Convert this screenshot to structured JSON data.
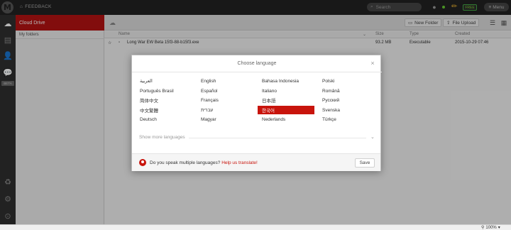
{
  "topbar": {
    "feedback_label": "FEEDBACK",
    "search_placeholder": "Search",
    "plan_badge": "FREE",
    "menu_label": "Menu"
  },
  "sidebar": {
    "cloud_drive_label": "Cloud Drive",
    "my_folders_label": "My folders",
    "rail_badge": "BETA"
  },
  "toolbar": {
    "new_folder_label": "New Folder",
    "file_upload_label": "File Upload"
  },
  "file_table": {
    "columns": [
      "Name",
      "Size",
      "Type",
      "Created"
    ],
    "rows": [
      {
        "name": "Long War EW Beta 15f3-88-b15f3.exe",
        "size": "93.2 MB",
        "type": "Executable",
        "created": "2015-10-29 07:46"
      }
    ]
  },
  "language_dialog": {
    "title": "Choose language",
    "close_symbol": "×",
    "selected_language": "한국어",
    "columns": [
      [
        "العربية",
        "Português Brasil",
        "简体中文",
        "中文繁體",
        "Deutsch"
      ],
      [
        "English",
        "Español",
        "Français",
        "עברית",
        "Magyar"
      ],
      [
        "Bahasa Indonesia",
        "Italiano",
        "日本語",
        "한국어",
        "Nederlands"
      ],
      [
        "Polski",
        "Română",
        "Русский",
        "Svenska",
        "Türkçe"
      ]
    ],
    "show_more_label": "Show more languages",
    "footer_question": "Do you speak multiple languages?",
    "footer_link": "Help us translate!",
    "save_label": "Save"
  },
  "statusbar": {
    "zoom_level": "100%"
  },
  "colors": {
    "accent_red": "#c8140c",
    "sidebar_red": "#b41212",
    "topbar_bg": "#222222",
    "badge_green": "#77cc33"
  }
}
